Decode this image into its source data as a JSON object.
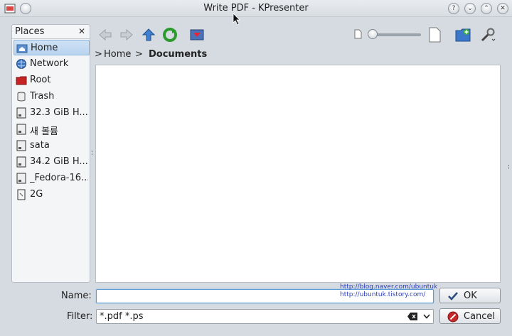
{
  "window": {
    "title": "Write PDF - KPresenter",
    "help_button": "?",
    "minimize_button": "⌄",
    "maximize_button": "⌃",
    "close_button": "✕"
  },
  "places": {
    "title": "Places",
    "close": "✕",
    "items": [
      {
        "label": "Home",
        "icon": "home-folder-icon",
        "selected": true
      },
      {
        "label": "Network",
        "icon": "network-globe-icon"
      },
      {
        "label": "Root",
        "icon": "red-folder-icon"
      },
      {
        "label": "Trash",
        "icon": "trash-icon"
      },
      {
        "label": "32.3 GiB H...",
        "icon": "hard-drive-icon"
      },
      {
        "label": "새 볼륨",
        "icon": "hard-drive-icon"
      },
      {
        "label": "sata",
        "icon": "hard-drive-icon"
      },
      {
        "label": "34.2 GiB H...",
        "icon": "hard-drive-icon"
      },
      {
        "label": "_Fedora-16...",
        "icon": "hard-drive-icon"
      },
      {
        "label": "2G",
        "icon": "usb-drive-icon"
      }
    ]
  },
  "breadcrumb": {
    "items": [
      "Home",
      "Documents"
    ],
    "separator": ">"
  },
  "form": {
    "name_label": "Name:",
    "name_value": "",
    "filter_label": "Filter:",
    "filter_value": "*.pdf *.ps"
  },
  "buttons": {
    "ok": "OK",
    "cancel": "Cancel"
  },
  "watermark": {
    "line1": "http://blog.naver.com/ubuntuk",
    "line2": "http://ubuntuk.tistory.com/"
  },
  "colors": {
    "accent": "#4a86c8",
    "selection": "#c5dcf3",
    "cancel_red": "#c62828",
    "ok_green": "#2e7d32"
  }
}
